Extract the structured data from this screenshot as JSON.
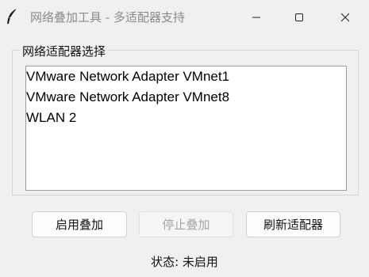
{
  "window": {
    "title": "网络叠加工具 - 多适配器支持",
    "icon": "feather-icon",
    "controls": [
      "minimize-icon",
      "maximize-icon",
      "close-icon"
    ]
  },
  "adapter_group": {
    "label": "网络适配器选择",
    "adapters": [
      "VMware Network Adapter VMnet1",
      "VMware Network Adapter VMnet8",
      "WLAN 2"
    ]
  },
  "buttons": {
    "start_label": "启用叠加",
    "stop_label": "停止叠加",
    "stop_enabled": false,
    "refresh_label": "刷新适配器"
  },
  "status": {
    "text": "状态: 未启用"
  },
  "colors": {
    "background": "#f0f0f0",
    "list_background": "#ffffff",
    "disabled_text": "#a6a6a6"
  }
}
